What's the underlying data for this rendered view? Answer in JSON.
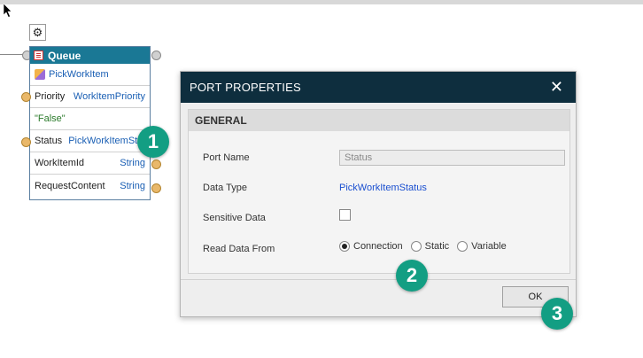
{
  "node": {
    "title": "Queue",
    "subtitle": "PickWorkItem",
    "rows": [
      {
        "label": "Priority",
        "type": "WorkItemPriority"
      },
      {
        "label": "\"False\"",
        "type": ""
      },
      {
        "label": "Status",
        "type": "PickWorkItemStatus"
      },
      {
        "label": "WorkItemId",
        "type": "String"
      },
      {
        "label": "RequestContent",
        "type": "String"
      }
    ]
  },
  "dialog": {
    "title": "PORT PROPERTIES",
    "close_glyph": "✕",
    "section": "GENERAL",
    "port_name_label": "Port Name",
    "port_name_value": "Status",
    "data_type_label": "Data Type",
    "data_type_value": "PickWorkItemStatus",
    "sensitive_label": "Sensitive Data",
    "sensitive_checked": false,
    "read_from_label": "Read Data From",
    "read_from_options": [
      "Connection",
      "Static",
      "Variable"
    ],
    "read_from_selected": "Connection",
    "ok_label": "OK"
  },
  "callouts": [
    "1",
    "2",
    "3"
  ],
  "icons": {
    "settings": "gear-icon",
    "close": "close-icon",
    "cursor": "pointer-cursor-icon"
  },
  "colors": {
    "node_header": "#1a7895",
    "dialog_title": "#0e2e3e",
    "callout": "#139e83",
    "type_text": "#1a5fb4"
  }
}
